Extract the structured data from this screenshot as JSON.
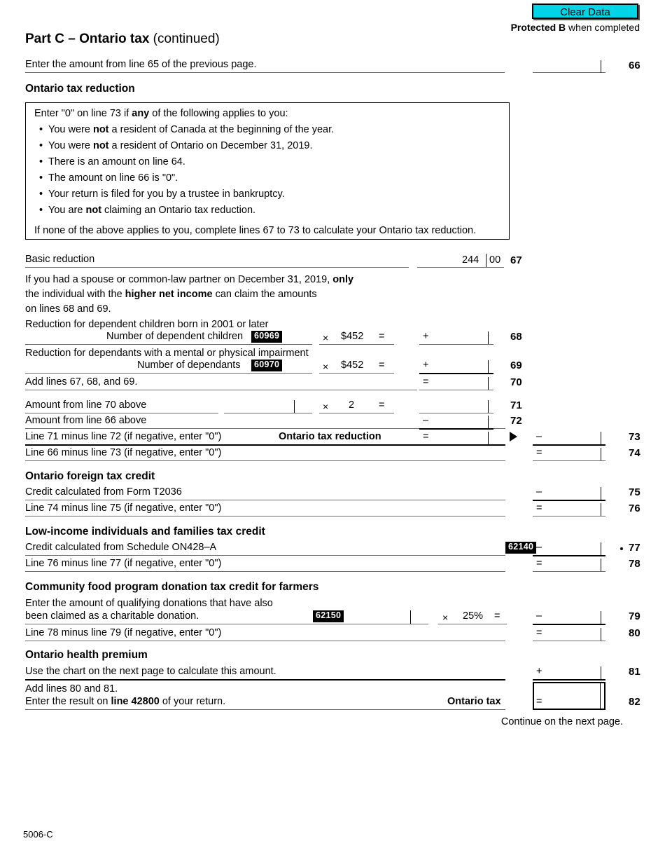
{
  "header": {
    "clear_data_label": "Clear Data",
    "protected_bold": "Protected B",
    "protected_rest": " when completed"
  },
  "title": {
    "bold": "Part C – Ontario tax",
    "normal": " (continued)"
  },
  "line66": {
    "text": "Enter the amount from line 65 of the previous page.",
    "number": "66"
  },
  "sections": {
    "tax_reduction": "Ontario tax reduction",
    "foreign_tax_credit": "Ontario foreign tax credit",
    "low_income": "Low-income individuals and families tax credit",
    "community_food": "Community food program donation tax credit for farmers",
    "health_premium": "Ontario health premium"
  },
  "notebox": {
    "intro_a": "Enter \"0\" on line 73 if ",
    "intro_b": "any",
    "intro_c": " of the following applies to you:",
    "bullets": [
      {
        "a": "You were ",
        "b": "not",
        "c": " a resident of Canada at the beginning of the year."
      },
      {
        "a": "You were ",
        "b": "not",
        "c": " a resident of Ontario on December 31, 2019."
      },
      {
        "a": "There is an amount on line 64.",
        "b": "",
        "c": ""
      },
      {
        "a": "The amount on line 66 is \"0\".",
        "b": "",
        "c": ""
      },
      {
        "a": "Your return is filed for you by a trustee in bankruptcy.",
        "b": "",
        "c": ""
      },
      {
        "a": "You are ",
        "b": "not",
        "c": " claiming an Ontario tax reduction."
      }
    ],
    "bullet_glyph": "•",
    "closing": "If none of the above applies to you, complete lines 67 to 73 to calculate your Ontario tax reduction."
  },
  "line67": {
    "label": "Basic reduction",
    "dollars": "244",
    "cents": "00",
    "number": "67"
  },
  "spouse_note": {
    "l1_a": "If you had a spouse or common-law partner on December 31, 2019, ",
    "l1_b": "only",
    "l2_a": "the individual with the ",
    "l2_b": "higher net income",
    "l2_c": " can claim the amounts",
    "l3": "on lines 68 and 69."
  },
  "line68": {
    "heading": "Reduction for dependent children born in 2001 or later",
    "label": "Number of dependent children",
    "code": "60969",
    "times": "×",
    "rate": "$452",
    "equals": "=",
    "sign": "+",
    "number": "68"
  },
  "line69": {
    "heading": "Reduction for dependants with a mental or physical impairment",
    "label": "Number of dependants",
    "code": "60970",
    "times": "×",
    "rate": "$452",
    "equals": "=",
    "sign": "+",
    "number": "69"
  },
  "line70": {
    "label": "Add lines 67, 68, and 69.",
    "sign": "=",
    "number": "70"
  },
  "line71": {
    "label": "Amount from line 70 above",
    "times": "×",
    "factor": "2",
    "equals": "=",
    "number": "71"
  },
  "line72": {
    "label": "Amount from line 66 above",
    "sign": "–",
    "number": "72"
  },
  "line73": {
    "label": "Line 71 minus line 72 (if negative, enter \"0\")",
    "bold_label": "Ontario tax reduction",
    "sign": "=",
    "sign2": "–",
    "number": "73"
  },
  "line74": {
    "label": "Line 66 minus line 73 (if negative, enter \"0\")",
    "sign": "=",
    "number": "74"
  },
  "line75": {
    "label": "Credit calculated from Form T2036",
    "sign": "–",
    "number": "75"
  },
  "line76": {
    "label": "Line 74 minus line 75 (if negative, enter \"0\")",
    "sign": "=",
    "number": "76"
  },
  "line77": {
    "label": "Credit calculated from Schedule ON428–A",
    "code": "62140",
    "sign": "–",
    "number": "77"
  },
  "line78": {
    "label": "Line 76 minus line 77 (if negative, enter \"0\")",
    "sign": "=",
    "number": "78"
  },
  "line79": {
    "label_l1": "Enter the amount of qualifying donations that have also",
    "label_l2": "been claimed as a charitable donation.",
    "code": "62150",
    "times": "×",
    "rate": "25%",
    "equals": "=",
    "sign": "–",
    "number": "79"
  },
  "line80": {
    "label": "Line 78 minus line 79 (if negative, enter \"0\")",
    "sign": "=",
    "number": "80"
  },
  "line81": {
    "label": "Use the chart on the next page to calculate this amount.",
    "sign": "+",
    "number": "81"
  },
  "line82": {
    "label_l1": "Add lines 80 and 81.",
    "label_l2_a": "Enter the result on ",
    "label_l2_b": "line 42800",
    "label_l2_c": " of your return.",
    "bold_label": "Ontario tax",
    "sign": "=",
    "number": "82"
  },
  "continue_note": "Continue on the next page.",
  "footer": "5006-C"
}
